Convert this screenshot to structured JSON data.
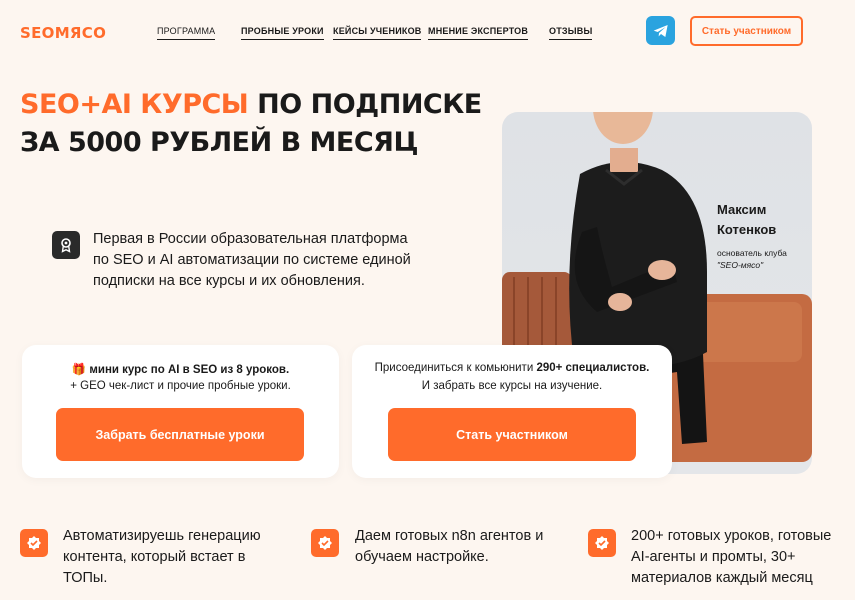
{
  "brand": {
    "logo": "SEOМЯСО",
    "accent": "#ff6b2b"
  },
  "nav": {
    "items": [
      {
        "label": "ПРОГРАММА"
      },
      {
        "label": "ПРОБНЫЕ УРОКИ"
      },
      {
        "label": "КЕЙСЫ УЧЕНИКОВ"
      },
      {
        "label": "МНЕНИЕ ЭКСПЕРТОВ"
      },
      {
        "label": "ОТЗЫВЫ"
      }
    ],
    "telegram_icon": "telegram-icon",
    "cta_label": "Стать участником"
  },
  "hero": {
    "title_accent": "SEO+AI КУРСЫ",
    "title_rest_line1": " ПО ПОДПИСКЕ",
    "title_line2": "ЗА 5000 РУБЛЕЙ В МЕСЯЦ",
    "description": "Первая в России образовательная платформа по SEO и AI автоматизации по системе единой подписки на все курсы и их обновления.",
    "award_icon": "award-icon"
  },
  "author": {
    "first_name": "Максим",
    "last_name": "Котенков",
    "role_prefix": "основатель клуба",
    "club": "\"SEO-мясо\""
  },
  "cards": {
    "free": {
      "gift_icon": "🎁",
      "line1_bold": "мини курс по AI в SEO из 8 уроков.",
      "line2": "+ GEO чек-лист и прочие пробные уроки.",
      "button": "Забрать бесплатные уроки"
    },
    "join": {
      "line1_prefix": "Присоединиться к комьюнити ",
      "line1_bold": "290+ специалистов.",
      "line2": "И забрать все курсы на изучение.",
      "button": "Стать участником"
    }
  },
  "features": [
    {
      "icon": "badge-check-icon",
      "text": "Автоматизируешь генерацию контента, который встает в ТОПы."
    },
    {
      "icon": "badge-check-icon",
      "text": "Даем готовых n8n агентов и обучаем настройке."
    },
    {
      "icon": "badge-check-icon",
      "text": "200+ готовых уроков, готовые AI-агенты и промты, 30+ материалов каждый месяц"
    }
  ]
}
